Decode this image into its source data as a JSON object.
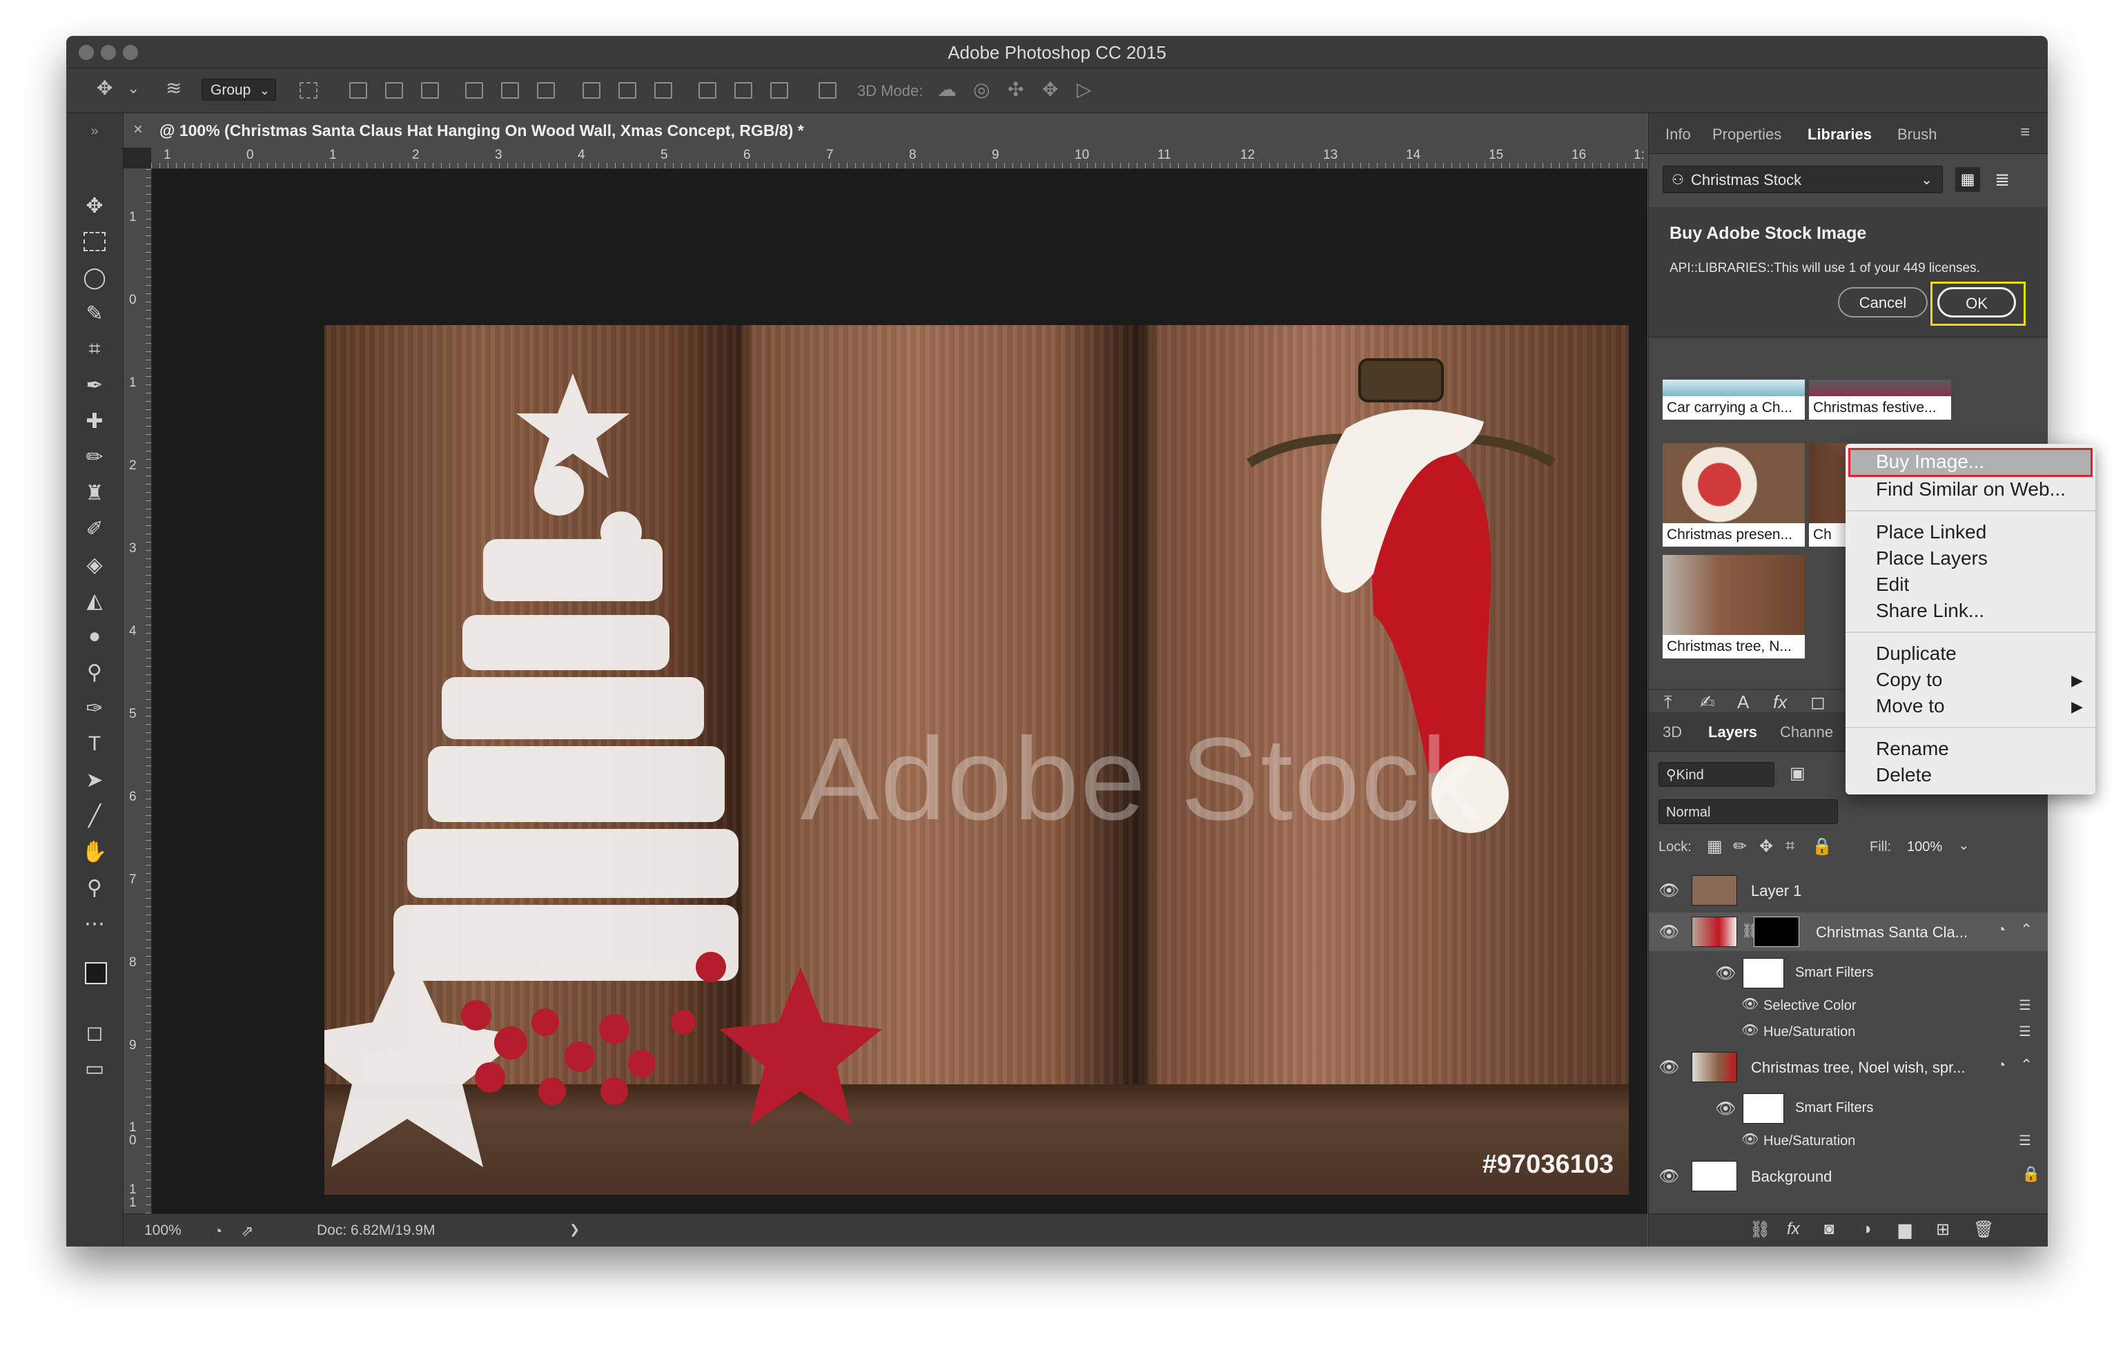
{
  "window": {
    "title": "Adobe Photoshop CC 2015"
  },
  "options_bar": {
    "auto_select_value": "Group",
    "three_d_mode_label": "3D Mode:"
  },
  "document": {
    "tab_title": "@ 100% (Christmas Santa Claus Hat Hanging On Wood Wall, Xmas Concept, RGB/8) *",
    "close_glyph": "×",
    "ruler_h_labels": [
      "1",
      "0",
      "1",
      "2",
      "3",
      "4",
      "5",
      "6",
      "7",
      "8",
      "9",
      "10",
      "11",
      "12",
      "13",
      "14",
      "15",
      "16",
      "1:"
    ],
    "ruler_v_labels": [
      "1",
      "0",
      "1",
      "2",
      "3",
      "4",
      "5",
      "6",
      "7",
      "8",
      "9",
      "1\n0",
      "1\n1"
    ],
    "watermark_text": "Adobe Stock",
    "stock_id": "#97036103",
    "zoom": "100%",
    "doc_size": "Doc: 6.82M/19.9M",
    "status_arrow": "❯"
  },
  "panel_tabs": [
    "Info",
    "Properties",
    "Libraries",
    "Brush"
  ],
  "panel_tab_active": "Libraries",
  "library": {
    "selected": "Christmas Stock"
  },
  "buy_dialog": {
    "heading": "Buy Adobe Stock Image",
    "message": "API::LIBRARIES::This will use 1 of your 449 licenses.",
    "cancel_label": "Cancel",
    "ok_label": "OK",
    "ok_highlight_color": "#e7e000"
  },
  "library_items": [
    {
      "caption": "Car carrying a Ch..."
    },
    {
      "caption": "Christmas festive..."
    },
    {
      "caption": "Christmas presen..."
    },
    {
      "caption": "Ch"
    },
    {
      "caption": "Christmas tree, N..."
    }
  ],
  "context_menu": {
    "highlight_color": "#e0202a",
    "items": [
      {
        "label": "Buy Image..."
      },
      {
        "label": "Find Similar on Web..."
      },
      {
        "label": "Place Linked"
      },
      {
        "label": "Place Layers"
      },
      {
        "label": "Edit"
      },
      {
        "label": "Share Link..."
      },
      {
        "label": "Duplicate"
      },
      {
        "label": "Copy to"
      },
      {
        "label": "Move to"
      },
      {
        "label": "Rename"
      },
      {
        "label": "Delete"
      }
    ],
    "submenu_arrow": "▶"
  },
  "layers_panel": {
    "tabs": [
      "3D",
      "Layers",
      "Channe"
    ],
    "active_tab": "Layers",
    "filter_kind": "Kind",
    "blend_mode": "Normal",
    "lock_label": "Lock:",
    "fill_label": "Fill:",
    "fill_value": "100%",
    "layers": [
      {
        "name": "Layer 1"
      },
      {
        "name": "Christmas Santa Cla..."
      },
      {
        "name": "Smart Filters"
      },
      {
        "name": "Selective Color"
      },
      {
        "name": "Hue/Saturation"
      },
      {
        "name": "Christmas tree, Noel wish, spr..."
      },
      {
        "name": "Smart Filters"
      },
      {
        "name": "Hue/Saturation"
      },
      {
        "name": "Background"
      }
    ]
  }
}
